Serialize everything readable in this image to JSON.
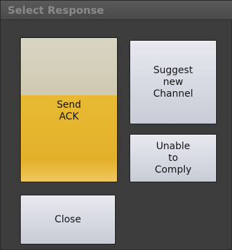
{
  "window": {
    "title": "Select Response"
  },
  "buttons": {
    "send_ack": "Send\nACK",
    "suggest_new_channel": "Suggest\nnew\nChannel",
    "unable_to_comply": "Unable\nto\nComply",
    "close": "Close"
  },
  "colors": {
    "panel_bg": "#3c3c3c",
    "title_text": "#8a8a8a",
    "ack_yellow": "#e5b22c",
    "ack_top": "#d3ceb7",
    "button_gray": "#d7dbe3"
  }
}
